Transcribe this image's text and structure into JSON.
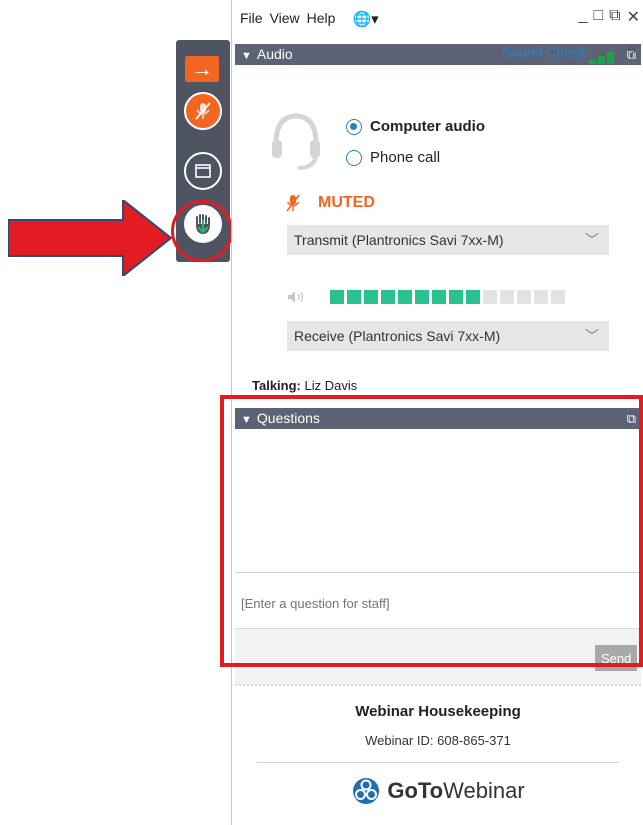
{
  "colors": {
    "accent_orange": "#f26522",
    "header_bg": "#5d6374",
    "toolbar_bg": "#4f5462",
    "annotation_red": "#e31b23",
    "link_blue": "#2a7fc1",
    "level_green": "#29c28e"
  },
  "menu": {
    "file": "File",
    "view": "View",
    "help": "Help"
  },
  "window_controls": {
    "minimize": "_",
    "restore": "□",
    "popout": "⧉",
    "close": "✕"
  },
  "audio": {
    "header": "Audio",
    "sound_check": "Sound Check",
    "help": "?",
    "options": [
      {
        "label": "Computer audio",
        "selected": true
      },
      {
        "label": "Phone call",
        "selected": false
      }
    ],
    "muted_label": "MUTED",
    "transmit_device": "Transmit (Plantronics Savi 7xx-M)",
    "receive_device": "Receive (Plantronics Savi 7xx-M)",
    "level_segments_on": 9,
    "level_segments_total": 14
  },
  "talking": {
    "label": "Talking:",
    "name": "Liz Davis"
  },
  "questions": {
    "header": "Questions",
    "input_placeholder": "[Enter a question for staff]",
    "send_label": "Send"
  },
  "footer": {
    "title": "Webinar Housekeeping",
    "webinar_id": "Webinar ID: 608-865-371",
    "logo_goto": "GoTo",
    "logo_webinar": "Webinar"
  },
  "icons": {
    "expand": "arrow-right-icon",
    "mic": "mic-muted-icon",
    "window": "window-icon",
    "hand": "raise-hand-icon",
    "globe": "globe-icon",
    "headset": "headset-icon",
    "speaker": "speaker-icon",
    "logo": "gotowebinar-logo-icon"
  }
}
